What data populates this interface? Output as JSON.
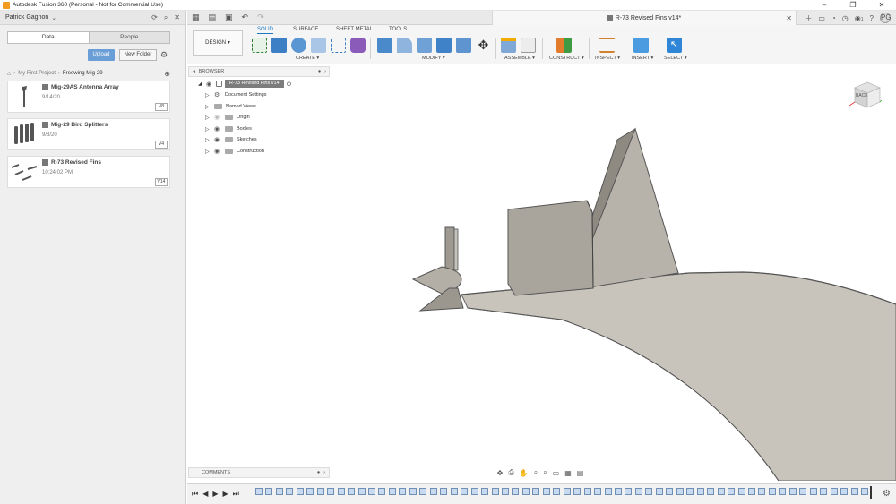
{
  "window": {
    "title": "Autodesk Fusion 360 (Personal - Not for Commercial Use)",
    "controls": [
      "–",
      "❐",
      "✕"
    ]
  },
  "data_panel": {
    "user": "Patrick Gagnon",
    "tabs": [
      "Data",
      "People"
    ],
    "upload_label": "Upload",
    "new_folder_label": "New Folder",
    "breadcrumb": [
      "My First Project",
      "Freewing Mig-29"
    ],
    "files": [
      {
        "name": "Mig-29AS Antenna Array",
        "date": "9/14/20",
        "version": "V8"
      },
      {
        "name": "Mig-29 Bird Splitters",
        "date": "9/8/20",
        "version": "V4"
      },
      {
        "name": "R-73 Revised Fins",
        "date": "10:24:02 PM",
        "version": "V14"
      }
    ]
  },
  "document": {
    "tab_title": "R-73 Revised Fins v14*"
  },
  "toolbar": {
    "workspace_label": "DESIGN",
    "tabs": [
      "SOLID",
      "SURFACE",
      "SHEET METAL",
      "TOOLS"
    ],
    "groups": [
      "CREATE",
      "MODIFY",
      "ASSEMBLE",
      "CONSTRUCT",
      "INSPECT",
      "INSERT",
      "SELECT"
    ]
  },
  "browser": {
    "title": "BROWSER",
    "root": "R-73 Revised Fins v14",
    "items": [
      "Document Settings",
      "Named Views",
      "Origin",
      "Bodies",
      "Sketches",
      "Construction"
    ]
  },
  "viewcube": {
    "face": "BACK"
  },
  "comments": {
    "title": "COMMENTS"
  },
  "avatar_initials": "PG",
  "notification_count": "1",
  "timeline_item_count": 60,
  "colors": {
    "accent": "#1f76c2",
    "upload": "#6a9ed6",
    "model": "#c8c4bb",
    "tile": "#c8daf0"
  }
}
